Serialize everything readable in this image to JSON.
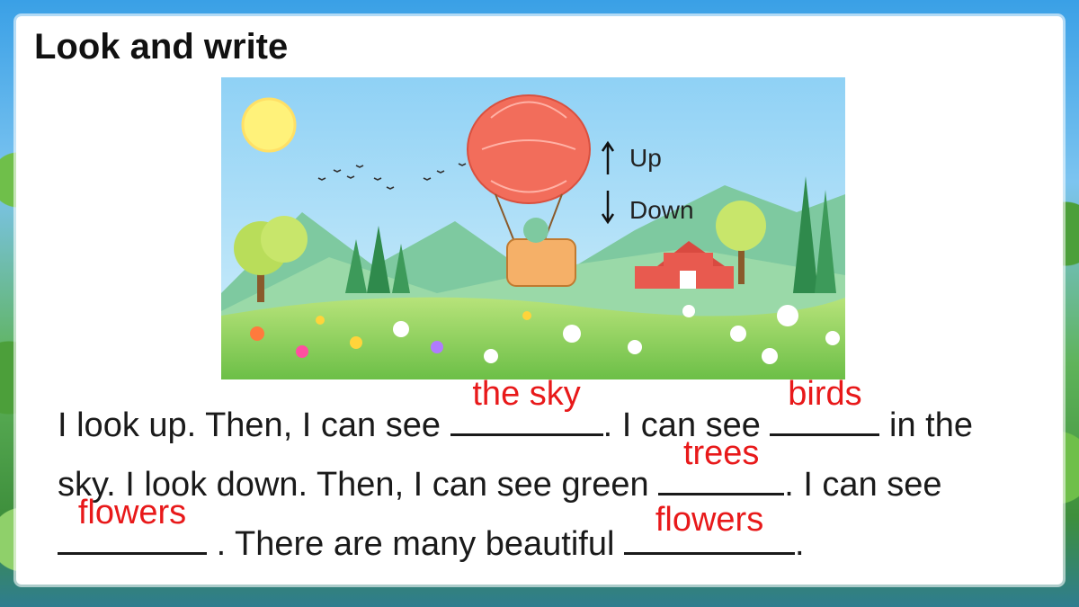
{
  "title": "Look and write",
  "scene": {
    "up_label": "Up",
    "down_label": "Down",
    "colors": {
      "sky": "#a9dcf7",
      "sun": "#fff27a",
      "balloon": "#f26d5b",
      "grass": "#8fd06a"
    }
  },
  "exercise": {
    "s1": "I look up. Then, I can see",
    "a1": "the sky",
    "s2": ". I can see",
    "a2": "birds",
    "s3": "in the sky. I look down. Then, I can see green",
    "a3": "trees",
    "s4": ". I can see",
    "a4": "flowers",
    "s5": ". There are many beautiful",
    "a5": "flowers",
    "s6": "."
  }
}
